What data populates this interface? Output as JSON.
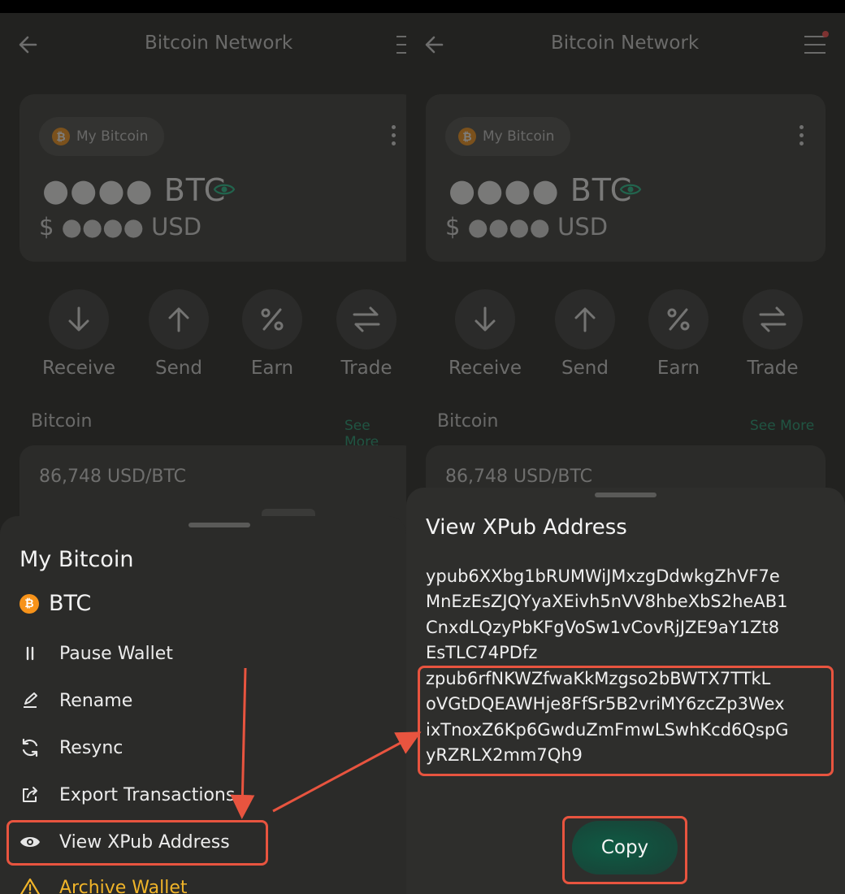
{
  "accent": "#1f9c74",
  "highlight_color": "#e8543f",
  "warning_color": "#f0b429",
  "screens": {
    "left": {
      "header": {
        "title": "Bitcoin Network"
      },
      "wallet": {
        "chip_label": "My Bitcoin",
        "balance_btc": "●●●● BTC",
        "balance_usd": "$ ●●●● USD"
      },
      "actions": [
        {
          "label": "Receive",
          "icon": "arrow-down-icon"
        },
        {
          "label": "Send",
          "icon": "arrow-up-icon"
        },
        {
          "label": "Earn",
          "icon": "percent-icon"
        },
        {
          "label": "Trade",
          "icon": "swap-icon"
        }
      ],
      "section": {
        "label": "Bitcoin",
        "see_more": "See More"
      },
      "price": "86,748 USD/BTC",
      "sheet": {
        "title": "My Bitcoin",
        "coin": "BTC",
        "items": [
          {
            "label": "Pause Wallet",
            "icon": "pause-icon"
          },
          {
            "label": "Rename",
            "icon": "pencil-icon"
          },
          {
            "label": "Resync",
            "icon": "sync-icon"
          },
          {
            "label": "Export Transactions",
            "icon": "export-icon"
          },
          {
            "label": "View XPub Address",
            "icon": "eye-icon"
          },
          {
            "label": "Archive Wallet",
            "icon": "warning-icon"
          }
        ]
      }
    },
    "right": {
      "header": {
        "title": "Bitcoin Network"
      },
      "wallet": {
        "chip_label": "My Bitcoin",
        "balance_btc": "●●●● BTC",
        "balance_usd": "$ ●●●● USD"
      },
      "actions": [
        {
          "label": "Receive",
          "icon": "arrow-down-icon"
        },
        {
          "label": "Send",
          "icon": "arrow-up-icon"
        },
        {
          "label": "Earn",
          "icon": "percent-icon"
        },
        {
          "label": "Trade",
          "icon": "swap-icon"
        }
      ],
      "section": {
        "label": "Bitcoin",
        "see_more": "See More"
      },
      "price": "86,748 USD/BTC",
      "xpub_sheet": {
        "title": "View XPub Address",
        "ypub_lines": [
          "ypub6XXbg1bRUMWiJMxzgDdwkgZhVF7e",
          "MnEzEsZJQYyaXEivh5nVV8hbeXbS2heAB1",
          "CnxdLQzyPbKFgVoSw1vCovRjJZE9aY1Zt8",
          "EsTLC74PDfz"
        ],
        "zpub_lines": [
          "zpub6rfNKWZfwaKkMzgso2bBWTX7TTkL",
          "oVGtDQEAWHje8FfSr5B2vriMY6zcZp3Wex",
          "ixTnoxZ6Kp6GwduZmFmwLSwhKcd6QspG",
          "yRZRLX2mm7Qh9"
        ],
        "copy_label": "Copy"
      }
    }
  }
}
